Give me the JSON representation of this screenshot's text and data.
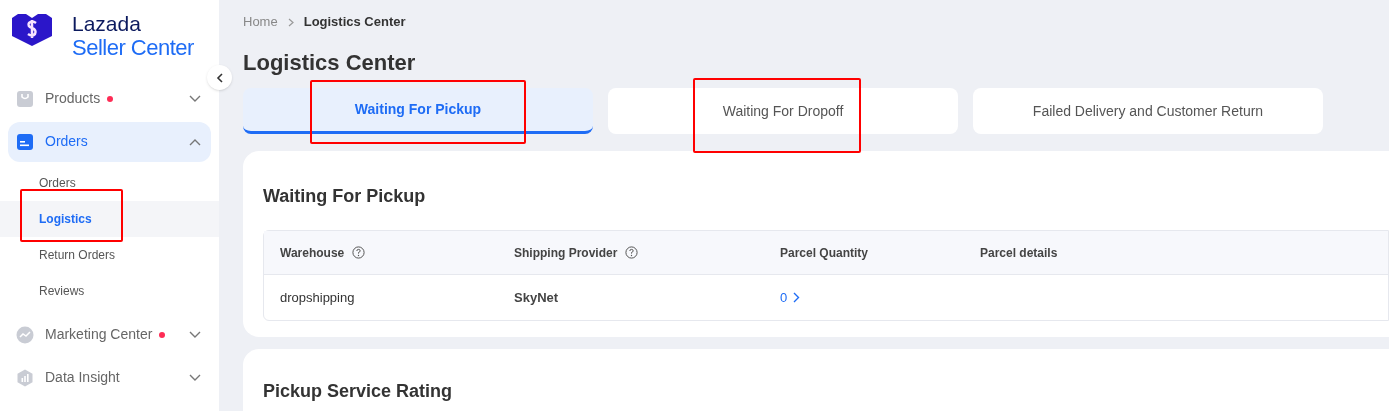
{
  "brand": {
    "line_1": "Lazada",
    "line_2": "Seller Center"
  },
  "sidebar": {
    "items": [
      {
        "label": "Products",
        "dot": true,
        "expanded": false,
        "selected": false
      },
      {
        "label": "Orders",
        "dot": false,
        "expanded": true,
        "selected": true,
        "children": [
          {
            "label": "Orders",
            "selected": false,
            "highlighted": false
          },
          {
            "label": "Logistics",
            "selected": true,
            "highlighted": true
          },
          {
            "label": "Return Orders",
            "selected": false,
            "highlighted": false
          },
          {
            "label": "Reviews",
            "selected": false,
            "highlighted": false
          }
        ]
      },
      {
        "label": "Marketing Center",
        "dot": true,
        "expanded": false,
        "selected": false
      },
      {
        "label": "Data Insight",
        "dot": false,
        "expanded": false,
        "selected": false
      }
    ]
  },
  "breadcrumb": [
    "Home",
    "Logistics Center"
  ],
  "title": "Logistics Center",
  "tabs": [
    {
      "label": "Waiting For Pickup",
      "selected": true,
      "highlighted": true
    },
    {
      "label": "Waiting For Dropoff",
      "selected": false,
      "highlighted": true
    },
    {
      "label": "Failed Delivery and Customer Return",
      "selected": false,
      "highlighted": false
    }
  ],
  "section": {
    "title": "Waiting For Pickup",
    "table": {
      "columns": [
        {
          "label": "Warehouse",
          "help": true
        },
        {
          "label": "Shipping Provider",
          "help": true
        },
        {
          "label": "Parcel Quantity",
          "help": false
        },
        {
          "label": "Parcel details",
          "help": false
        }
      ],
      "rows": [
        [
          "dropshipping",
          "SkyNet",
          "0",
          ""
        ]
      ]
    }
  },
  "section_2": {
    "title": "Pickup Service Rating"
  }
}
